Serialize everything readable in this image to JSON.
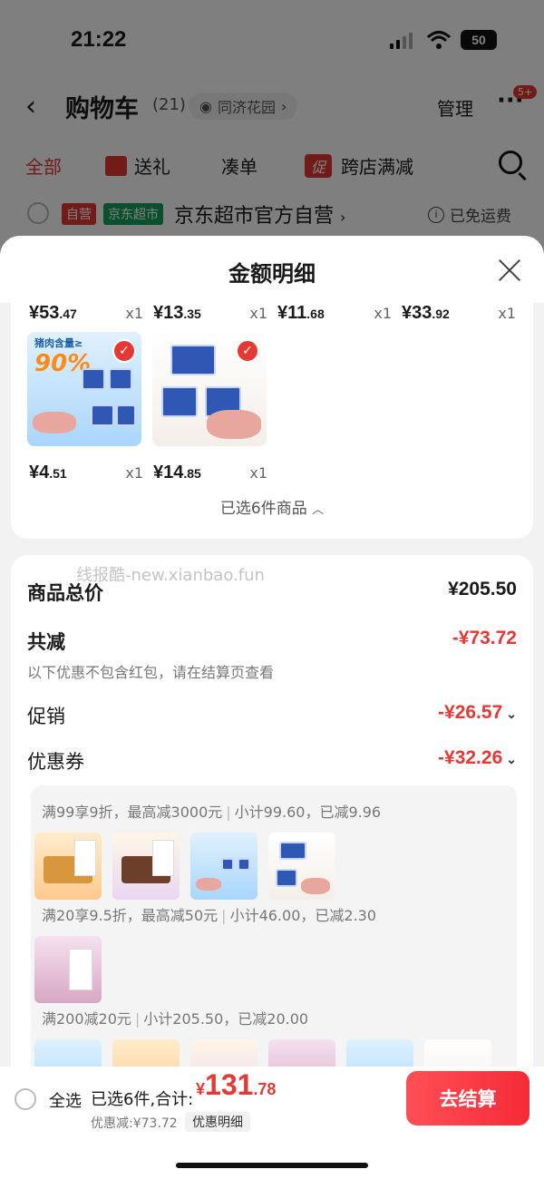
{
  "status_bar": {
    "time": "21:22",
    "battery": "50"
  },
  "nav": {
    "back_icon": "chevron-left-icon",
    "title": "购物车",
    "count": "(21)",
    "location": "同济花园",
    "manage": "管理",
    "more_badge": "5+"
  },
  "tabs": [
    {
      "label": "全部"
    },
    {
      "label": "送礼"
    },
    {
      "label": "凑单"
    },
    {
      "label": "跨店满减"
    }
  ],
  "promo_icon_text": "促",
  "shop": {
    "tag_self": "自营",
    "tag_market": "京东超市",
    "name": "京东超市官方自营",
    "shipping": "已免运费",
    "info_icon": "i"
  },
  "sheet": {
    "title": "金额明细",
    "row1_prices": [
      {
        "int": "¥53",
        "dec": ".47",
        "qty": "x1"
      },
      {
        "int": "¥13",
        "dec": ".35",
        "qty": "x1"
      },
      {
        "int": "¥11",
        "dec": ".68",
        "qty": "x1"
      },
      {
        "int": "¥33",
        "dec": ".92",
        "qty": "x1"
      }
    ],
    "row2_prices": [
      {
        "int": "¥4",
        "dec": ".51",
        "qty": "x1"
      },
      {
        "int": "¥14",
        "dec": ".85",
        "qty": "x1"
      }
    ],
    "thumb_text": {
      "label": "猪肉含量≥",
      "pct": "90%"
    },
    "selected_text": "已选6件商品"
  },
  "summary": {
    "watermark": "线报酷-new.xianbao.fun",
    "total_label": "商品总价",
    "total_value": "¥205.50",
    "reduce_label": "共减",
    "reduce_value": "-¥73.72",
    "note": "以下优惠不包含红包，请在结算页查看",
    "promo_label": "促销",
    "promo_value": "-¥26.57",
    "coupon_label": "优惠券",
    "coupon_value": "-¥32.26"
  },
  "coupon_rules": [
    {
      "rule": "满99享9折，最高减3000元",
      "detail": "小计99.60，已减9.96"
    },
    {
      "rule": "满20享9.5折，最高减50元",
      "detail": "小计46.00，已减2.30"
    },
    {
      "rule": "满200减20元",
      "detail": "小计205.50，已减20.00"
    }
  ],
  "bottom_bar": {
    "select_all": "全选",
    "selected": "已选6件,合计:",
    "yen": "¥",
    "total_int": "131",
    "total_dec": ".78",
    "discount": "优惠减:¥73.72",
    "detail": "优惠明细",
    "checkout": "去结算"
  },
  "colors": {
    "accent": "#e53935",
    "market_green": "#15a05a",
    "checkout": "#f42b37"
  }
}
